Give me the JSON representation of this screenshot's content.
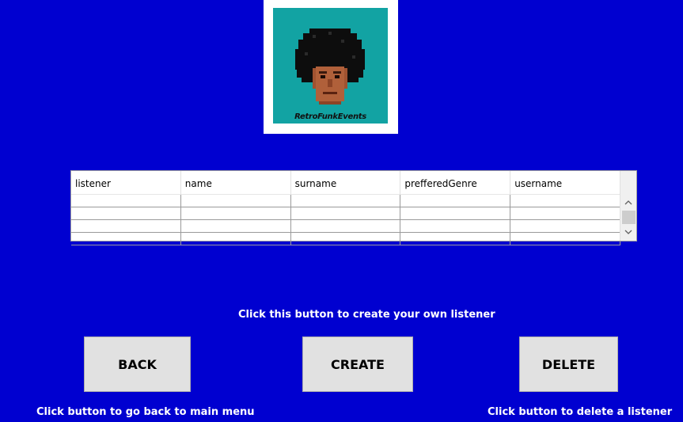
{
  "logo": {
    "text": "RetroFunkEvents"
  },
  "table": {
    "columns": [
      "listener",
      "name",
      "surname",
      "prefferedGenre",
      "username"
    ],
    "rows": [
      [
        "",
        "",
        "",
        "",
        ""
      ],
      [
        "",
        "",
        "",
        "",
        ""
      ],
      [
        "",
        "",
        "",
        "",
        ""
      ],
      [
        "",
        "",
        "",
        "",
        ""
      ]
    ]
  },
  "scrollbar": {
    "up_icon": "chevron-up",
    "down_icon": "chevron-down"
  },
  "messages": {
    "create_hint": "Click this button to create your own listener",
    "back_hint": "Click button to go back to main menu",
    "delete_hint": "Click button to delete a listener"
  },
  "buttons": {
    "back": "BACK",
    "create": "CREATE",
    "delete": "DELETE"
  },
  "colors": {
    "background": "#0000d0",
    "logo_bg": "#12a3a3",
    "button_bg": "#e1e1e1"
  }
}
